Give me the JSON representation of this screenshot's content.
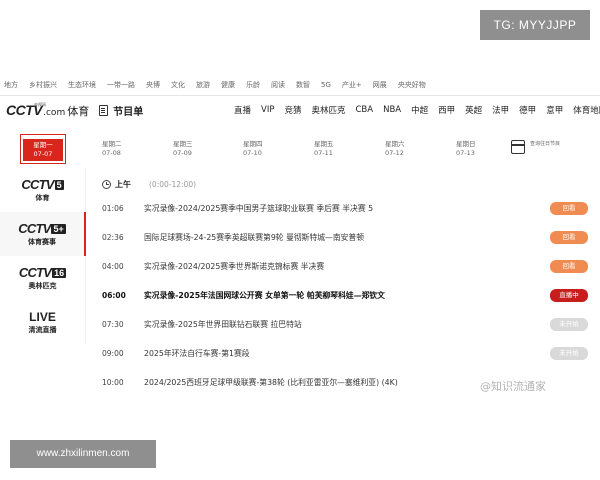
{
  "watermark_top": "TG: MYYJJPP",
  "watermark_bottom": "www.zhxilinmen.com",
  "watermark_corner": "@知识流通家",
  "top_nav": [
    "地方",
    "乡村振兴",
    "生态环境",
    "一带一路",
    "央博",
    "文化",
    "旅游",
    "健康",
    "乐龄",
    "阅读",
    "数智",
    "5G",
    "产业+",
    "网展",
    "央央好物"
  ],
  "logo": {
    "cctv": "CCTV",
    "com": ".com",
    "sport": "体育",
    "sub": "央视网"
  },
  "schedule_title": "节目单",
  "channels_nav": [
    "直播",
    "VIP",
    "竞猜",
    "奥林匹克",
    "CBA",
    "NBA",
    "中超",
    "西甲",
    "英超",
    "法甲",
    "德甲",
    "意甲"
  ],
  "channels_more": "体育地图",
  "dates": [
    {
      "day": "星期一",
      "date": "07-07",
      "active": true
    },
    {
      "day": "星期二",
      "date": "07-08"
    },
    {
      "day": "星期三",
      "date": "07-09"
    },
    {
      "day": "星期四",
      "date": "07-10"
    },
    {
      "day": "星期五",
      "date": "07-11"
    },
    {
      "day": "星期六",
      "date": "07-12"
    },
    {
      "day": "星期日",
      "date": "07-13"
    }
  ],
  "calendar_label": "查询往日节目",
  "sidebar": [
    {
      "cctv": "CCTV",
      "num": "5",
      "name": "体育"
    },
    {
      "cctv": "CCTV",
      "num": "5+",
      "name": "体育赛事",
      "active": true
    },
    {
      "cctv": "CCTV",
      "num": "16",
      "name": "奥林匹克"
    },
    {
      "live": "LIVE",
      "name": "清流直播"
    }
  ],
  "period": {
    "label": "上午",
    "range": "(0:00-12:00)"
  },
  "programs": [
    {
      "time": "01:06",
      "title": "实况录像-2024/2025赛季中国男子篮球职业联赛 季后赛 半决赛 5",
      "status": "回看",
      "kind": "replay"
    },
    {
      "time": "02:36",
      "title": "国际足球赛场-24-25赛季英超联赛第9轮 曼彻斯特城—南安普顿",
      "status": "回看",
      "kind": "replay"
    },
    {
      "time": "04:00",
      "title": "实况录像-2024/2025赛季世界斯诺克锦标赛 半决赛",
      "status": "回看",
      "kind": "replay"
    },
    {
      "time": "06:00",
      "title": "实况录像-2025年法国网球公开赛 女单第一轮 帕芙柳琴科娃—郑钦文",
      "status": "直播中",
      "kind": "live"
    },
    {
      "time": "07:30",
      "title": "实况录像-2025年世界田联钻石联赛 拉巴特站",
      "status": "未开始",
      "kind": "soon"
    },
    {
      "time": "09:00",
      "title": "2025年环法自行车赛-第1赛段",
      "status": "未开始",
      "kind": "soon"
    },
    {
      "time": "10:00",
      "title": "2024/2025西班牙足球甲级联赛-第38轮 (比利亚雷亚尔—塞维利亚)  (4K)",
      "status": "",
      "kind": "none"
    }
  ]
}
